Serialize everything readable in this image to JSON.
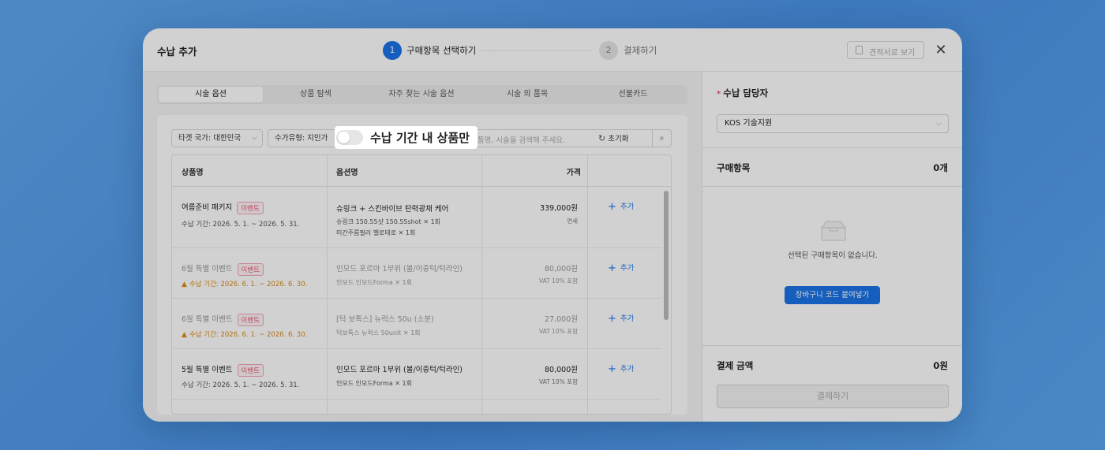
{
  "header": {
    "title": "수납 추가",
    "step1_num": "1",
    "step1_label": "구매항목 선택하기",
    "step2_num": "2",
    "step2_label": "결제하기",
    "quote_label": "견적서로 보기",
    "close": "✕"
  },
  "tabs": [
    "시술 옵션",
    "상품 탐색",
    "자주 찾는 시술 옵션",
    "시술 외 품목",
    "선불카드"
  ],
  "filters": {
    "country": "타겟 국가: 대한민국",
    "price_type": "수가유형: 지인가",
    "search_placeholder": "상품명, 시술을 검색해 주세요.",
    "reset_label": "초기화",
    "chevron": "⌵"
  },
  "toggle": {
    "label": "수납 기간 내 상품만"
  },
  "table": {
    "headers": {
      "product": "상품명",
      "option": "옵션명",
      "price": "가격"
    },
    "add_label": "추가",
    "rows": [
      {
        "name": "여름준비 패키지",
        "badge": "이벤트",
        "period": "수납 기간: 2026. 5. 1. ~ 2026. 5. 31.",
        "option": "슈링크 + 스킨바이브 탄력광채 케어",
        "detail1": "슈링크 150.55샷 150.55shot ✕ 1회",
        "detail2": "미간주름필러 벨로테로 ✕ 1회",
        "price": "339,000원",
        "price_sub": "면세"
      },
      {
        "name": "6월 특별 이벤트",
        "badge": "이벤트",
        "period": "수납 기간: 2026. 6. 1. ~ 2026. 6. 30.",
        "option": "인모드 포르마 1부위 (볼/이중턱/턱라인)",
        "detail1": "인모드 인모드Forma ✕ 1회",
        "price": "80,000원",
        "price_sub": "VAT 10% 포함"
      },
      {
        "name": "6월 특별 이벤트",
        "badge": "이벤트",
        "period": "수납 기간: 2026. 6. 1. ~ 2026. 6. 30.",
        "option": "[턱 보톡스] 뉴럭스 50u (소분)",
        "detail1": "턱보톡스 뉴럭스 50unit ✕ 1회",
        "price": "27,000원",
        "price_sub": "VAT 10% 포함"
      },
      {
        "name": "5월 특별 이벤트",
        "badge": "이벤트",
        "period": "수납 기간: 2026. 5. 1. ~ 2026. 5. 31.",
        "option": "인모드 포르마 1부위 (볼/이중턱/턱라인)",
        "detail1": "인모드 인모드Forma ✕ 1회",
        "price": "80,000원",
        "price_sub": "VAT 10% 포함"
      }
    ]
  },
  "right": {
    "manager_title": "수납 담당자",
    "manager_value": "KOS 기술지원",
    "items_title": "구매항목",
    "items_count": "0개",
    "empty_text": "선택된 구매항목이 없습니다.",
    "paste_label": "장바구니 코드 붙여넣기",
    "total_title": "결제 금액",
    "total_value": "0원",
    "pay_label": "결제하기"
  },
  "colors": {
    "accent": "#1a73e8",
    "badge": "#e35a74",
    "warn": "#d98a1a",
    "background": "#5fa8ef"
  }
}
